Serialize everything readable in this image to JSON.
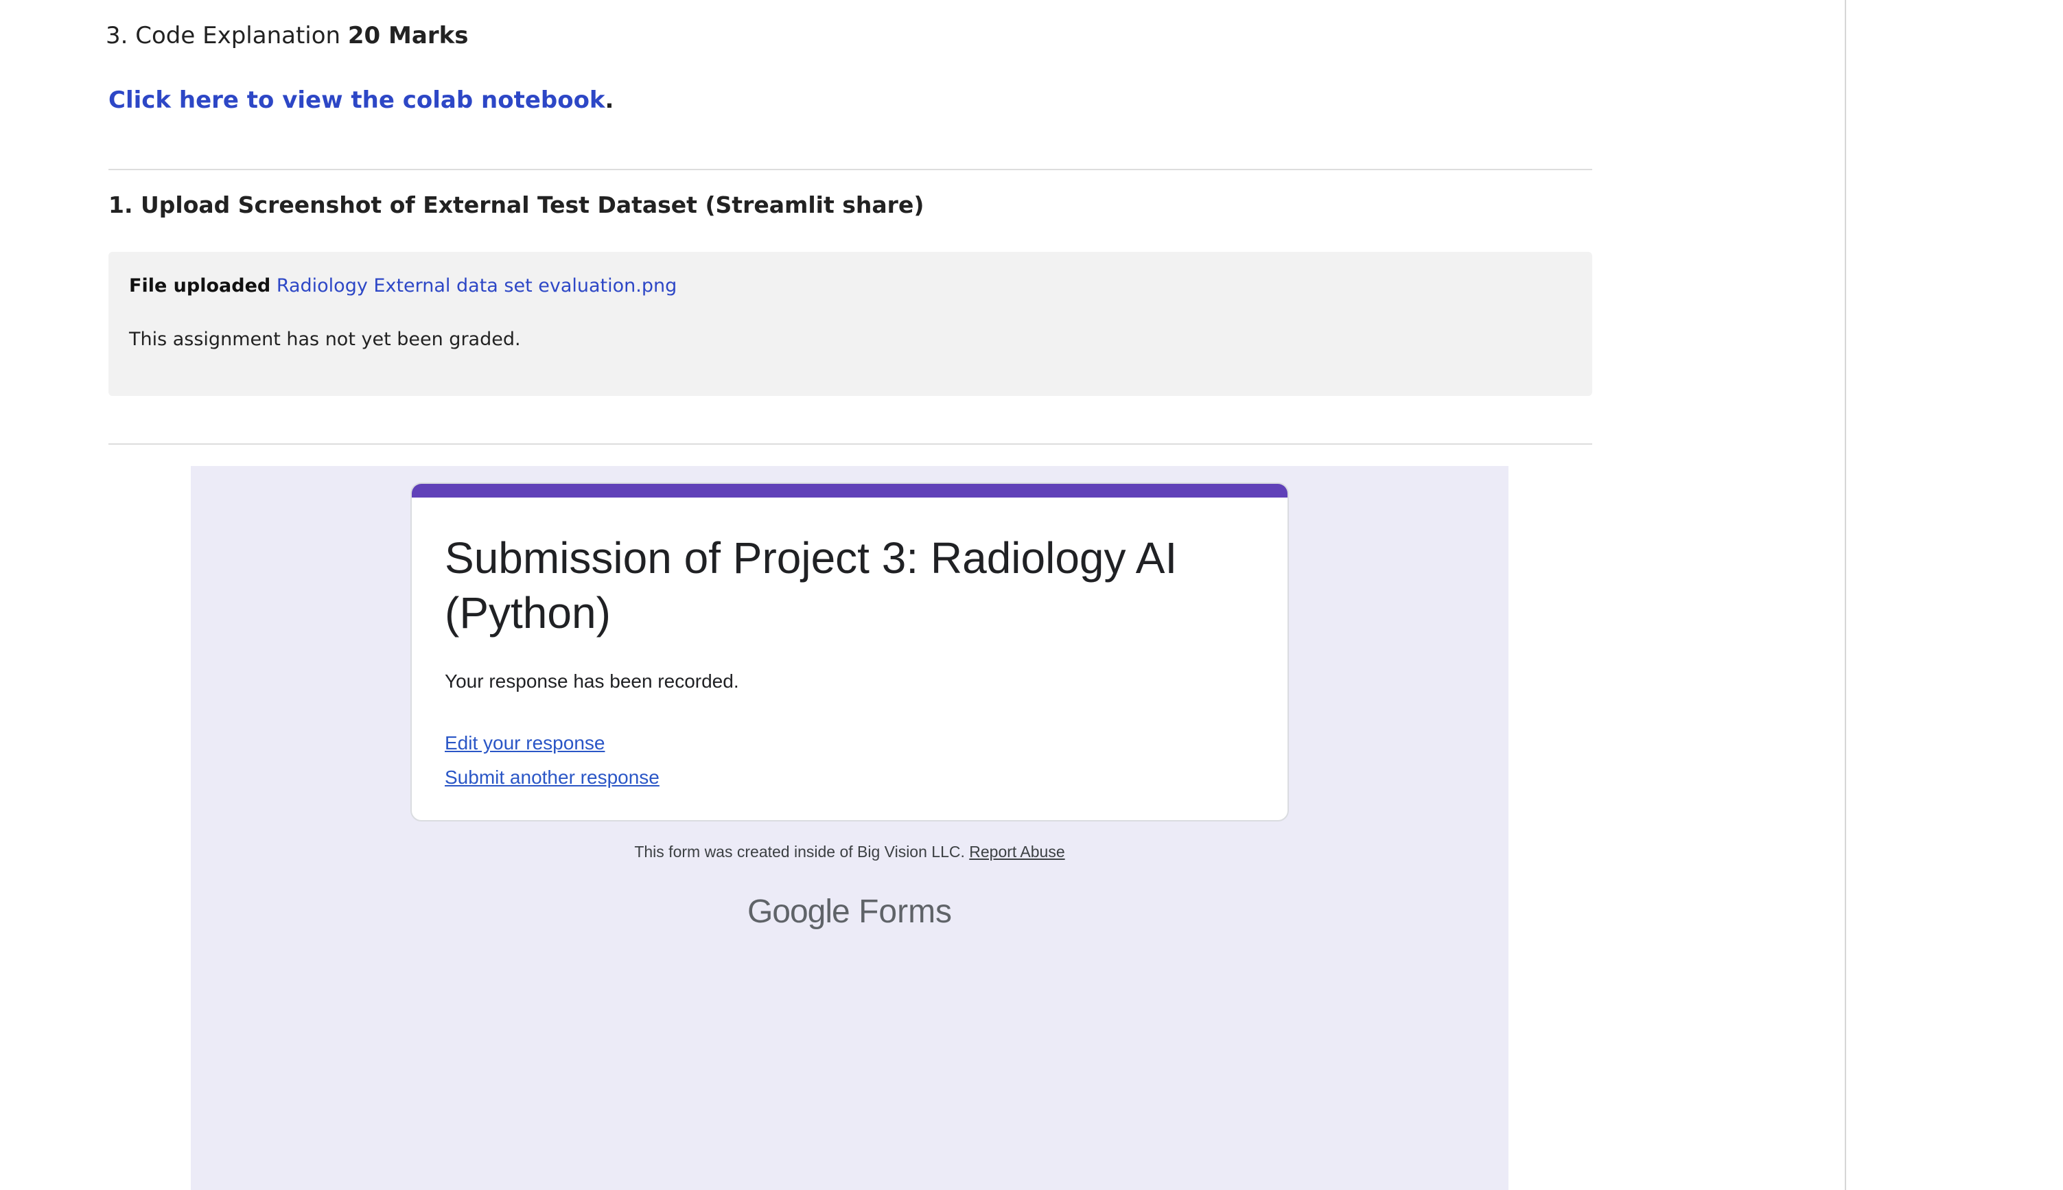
{
  "assignment": {
    "partial_top_text": "",
    "rubric_item": {
      "text": "3. Code Explanation ",
      "marks": "20 Marks"
    },
    "colab": {
      "link_text": "Click here to view the colab notebook",
      "trailing": "."
    },
    "question": {
      "title": "1. Upload Screenshot of External Test Dataset (Streamlit share)"
    },
    "upload": {
      "label": "File uploaded",
      "file_name": "Radiology External data set evaluation.png",
      "grade_status": "This assignment has not yet been graded."
    }
  },
  "google_form": {
    "accent_color": "#6041b8",
    "background_color": "#ecebf7",
    "title": "Submission of Project 3: Radiology AI (Python)",
    "confirmation": "Your response has been recorded.",
    "edit_link": "Edit your response",
    "submit_another_link": "Submit another response",
    "footer_text": "This form was created inside of Big Vision LLC.",
    "report_abuse": "Report Abuse",
    "logo": {
      "google": "Google",
      "forms": "Forms"
    }
  }
}
